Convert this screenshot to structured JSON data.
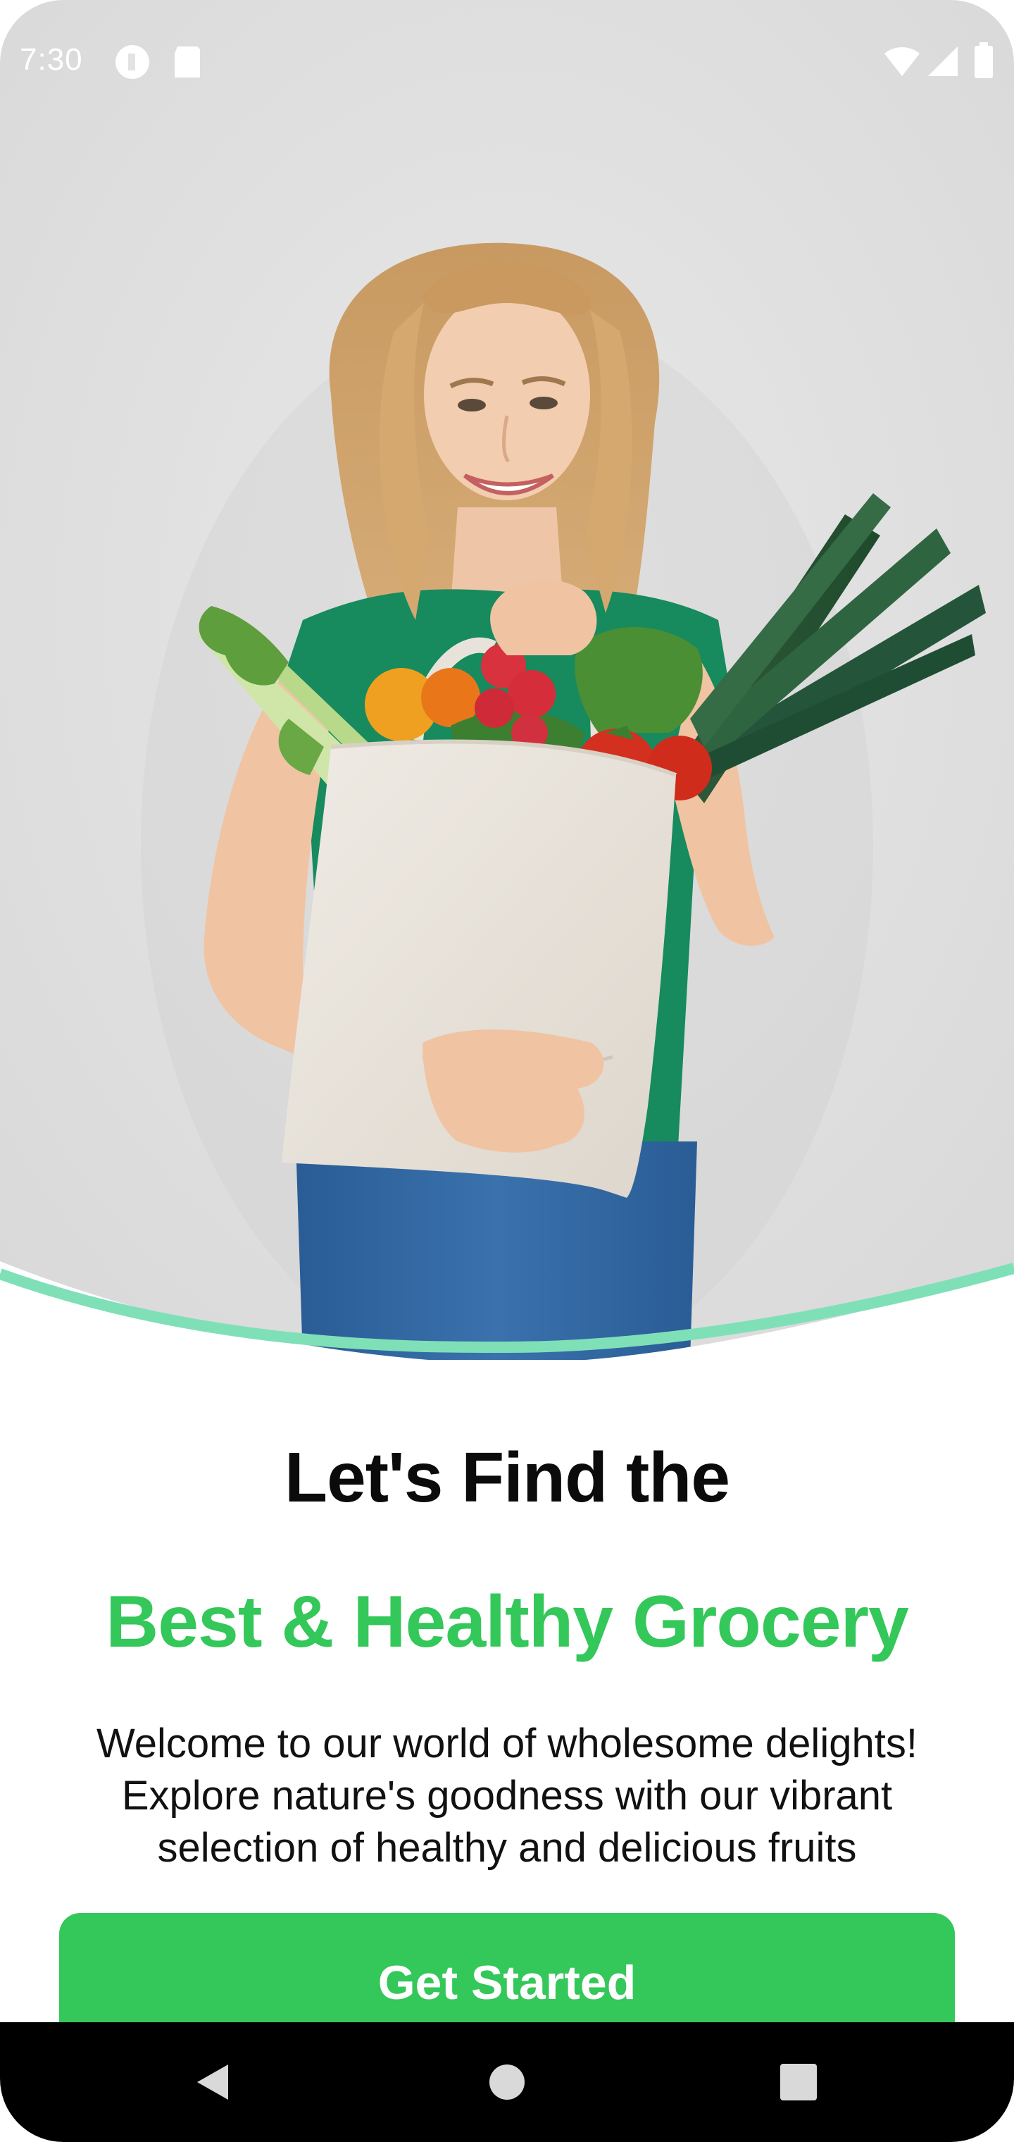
{
  "status_bar": {
    "time": "7:30",
    "icons": [
      "privacy-indicator-icon",
      "sd-card-icon",
      "wifi-icon",
      "signal-icon",
      "battery-icon"
    ]
  },
  "hero": {
    "image": "woman-holding-grocery-bag-photo",
    "curve_color": "#7fe0b8"
  },
  "content": {
    "headline_line1": "Let's Find the",
    "headline_line2": "Best & Healthy Grocery",
    "description": "Welcome to our world of wholesome delights! Explore nature's goodness with our vibrant selection of healthy and delicious fruits",
    "cta_label": "Get Started"
  },
  "colors": {
    "accent": "#34c759",
    "headline": "#0b0b0b"
  },
  "nav_bar": {
    "buttons": [
      "back-icon",
      "home-icon",
      "recents-icon"
    ]
  }
}
